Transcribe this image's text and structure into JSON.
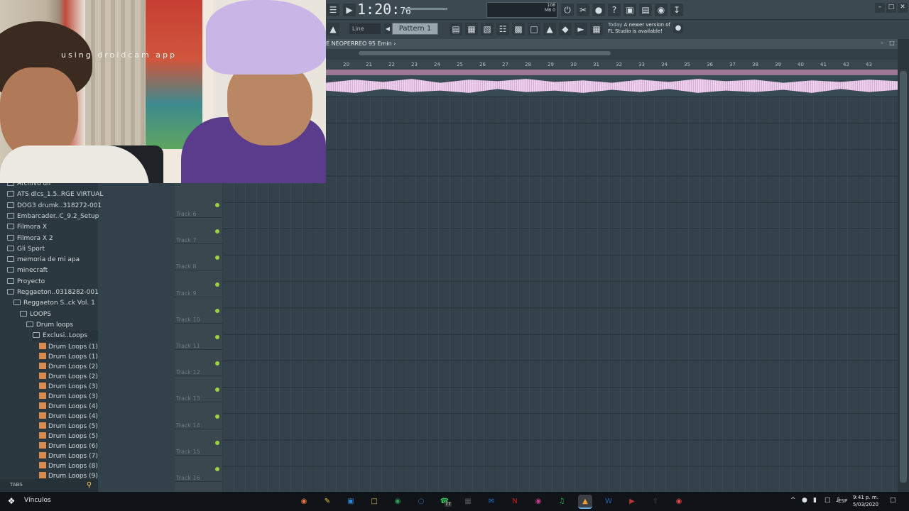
{
  "webcam": {
    "overlay_text": "using droidcam app"
  },
  "toolbar": {
    "time_main": "1:20:",
    "time_sub": "76",
    "tempo_readout": "108 MB\n0",
    "snap_label": "Line",
    "pattern_label": "Pattern 1",
    "news_line1_prefix": "Today",
    "news_line1": "A newer version of",
    "news_line2": "FL Studio is available!"
  },
  "playlist": {
    "title": "E NEOPERREO 95 Emin ›",
    "ruler": [
      "20",
      "21",
      "22",
      "23",
      "24",
      "25",
      "26",
      "27",
      "28",
      "29",
      "30",
      "31",
      "32",
      "33",
      "34",
      "35",
      "36",
      "37",
      "38",
      "39",
      "40",
      "41",
      "42",
      "43"
    ]
  },
  "tracks": [
    "Track 6",
    "Track 7",
    "Track 8",
    "Track 9",
    "Track 10",
    "Track 11",
    "Track 12",
    "Track 13",
    "Track 14",
    "Track 15",
    "Track 16"
  ],
  "browser": {
    "items": [
      {
        "label": "Archivo dll",
        "indent": 0,
        "kind": "folder"
      },
      {
        "label": "ATS dlcs_1.5..RGE VIRTUAL",
        "indent": 0,
        "kind": "folder"
      },
      {
        "label": "DOG3 drumk..318272-001",
        "indent": 0,
        "kind": "folder"
      },
      {
        "label": "Embarcader..C_9.2_Setup",
        "indent": 0,
        "kind": "folder"
      },
      {
        "label": "Filmora X",
        "indent": 0,
        "kind": "folder"
      },
      {
        "label": "Filmora X 2",
        "indent": 0,
        "kind": "folder"
      },
      {
        "label": "Gli Sport",
        "indent": 0,
        "kind": "folder"
      },
      {
        "label": "memoria de mi apa",
        "indent": 0,
        "kind": "folder"
      },
      {
        "label": "minecraft",
        "indent": 0,
        "kind": "folder"
      },
      {
        "label": "Proyecto",
        "indent": 0,
        "kind": "folder"
      },
      {
        "label": "Reggaeton..0318282-001",
        "indent": 0,
        "kind": "folder"
      },
      {
        "label": "Reggaeton S..ck Vol. 1",
        "indent": 1,
        "kind": "folder"
      },
      {
        "label": "LOOPS",
        "indent": 2,
        "kind": "folder"
      },
      {
        "label": "Drum loops",
        "indent": 3,
        "kind": "folder"
      },
      {
        "label": "Exclusi..Loops",
        "indent": 4,
        "kind": "folder",
        "selected": true
      },
      {
        "label": "Drum Loops (1)",
        "indent": 5,
        "kind": "file"
      },
      {
        "label": "Drum Loops (1)",
        "indent": 5,
        "kind": "file"
      },
      {
        "label": "Drum Loops (2)",
        "indent": 5,
        "kind": "file"
      },
      {
        "label": "Drum Loops (2)",
        "indent": 5,
        "kind": "file"
      },
      {
        "label": "Drum Loops (3)",
        "indent": 5,
        "kind": "file"
      },
      {
        "label": "Drum Loops (3)",
        "indent": 5,
        "kind": "file"
      },
      {
        "label": "Drum Loops (4)",
        "indent": 5,
        "kind": "file"
      },
      {
        "label": "Drum Loops (4)",
        "indent": 5,
        "kind": "file"
      },
      {
        "label": "Drum Loops (5)",
        "indent": 5,
        "kind": "file"
      },
      {
        "label": "Drum Loops (5)",
        "indent": 5,
        "kind": "file"
      },
      {
        "label": "Drum Loops (6)",
        "indent": 5,
        "kind": "file"
      },
      {
        "label": "Drum Loops (7)",
        "indent": 5,
        "kind": "file"
      },
      {
        "label": "Drum Loops (8)",
        "indent": 5,
        "kind": "file"
      },
      {
        "label": "Drum Loops (9)",
        "indent": 5,
        "kind": "file"
      }
    ],
    "footer_label": "TABS"
  },
  "taskbar": {
    "links_label": "Vínculos",
    "apps": [
      "firefox",
      "file-manager",
      "store",
      "folder",
      "chrome",
      "steam",
      "whatsapp",
      "calculator",
      "outlook",
      "netflix",
      "instagram",
      "spotify",
      "fl-studio",
      "word",
      "media",
      "upload",
      "chrome-alt"
    ],
    "whatsapp_badge": "77",
    "language": "ESP",
    "time": "9:41 p. m.",
    "date": "5/03/2020"
  },
  "colors": {
    "accent": "#9bd23c",
    "waveform": "#e9c8e8",
    "clip_header": "#9a7896"
  }
}
